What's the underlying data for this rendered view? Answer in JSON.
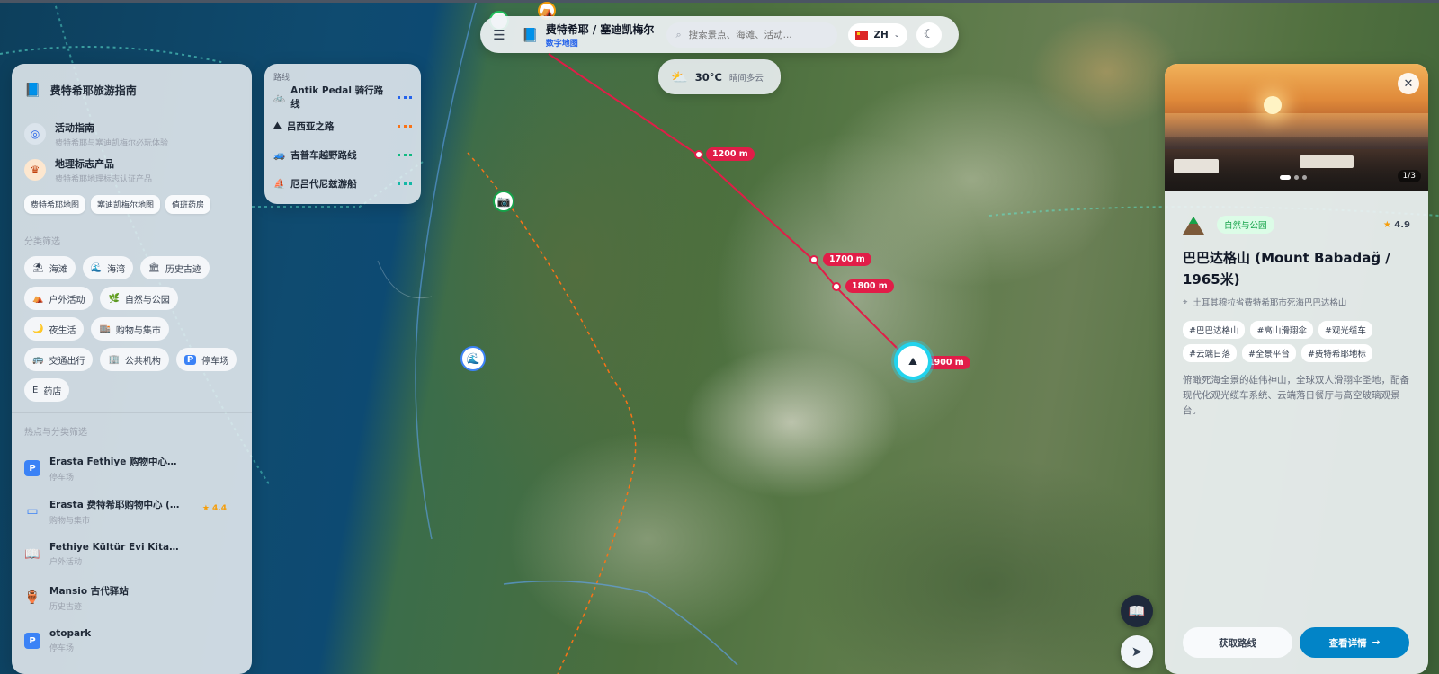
{
  "app": {
    "title": "费特希耶 / 塞迪凯梅尔",
    "subtitle": "数字地图"
  },
  "search": {
    "placeholder": "搜索景点、海滩、活动..."
  },
  "language": {
    "code": "ZH"
  },
  "weather": {
    "temp": "30°C",
    "desc": "晴间多云"
  },
  "left_panel": {
    "title": "费特希耶旅游指南",
    "nav": [
      {
        "title": "活动指南",
        "subtitle": "费特希耶与塞迪凯梅尔必玩体验",
        "icon": "compass-icon"
      },
      {
        "title": "地理标志产品",
        "subtitle": "费特希耶地理标志认证产品",
        "icon": "badge-icon"
      }
    ],
    "map_links": [
      "费特希耶地图",
      "塞迪凯梅尔地图",
      "值班药房"
    ],
    "category_label": "分类筛选",
    "categories": [
      {
        "label": "海滩",
        "icon": "umbrella-icon"
      },
      {
        "label": "海湾",
        "icon": "wave-icon"
      },
      {
        "label": "历史古迹",
        "icon": "temple-icon"
      },
      {
        "label": "户外活动",
        "icon": "tent-icon"
      },
      {
        "label": "自然与公园",
        "icon": "leaf-icon"
      },
      {
        "label": "夜生活",
        "icon": "moon-icon"
      },
      {
        "label": "购物与集市",
        "icon": "shop-icon"
      },
      {
        "label": "交通出行",
        "icon": "bus-icon"
      },
      {
        "label": "公共机构",
        "icon": "building-icon"
      },
      {
        "label": "停车场",
        "icon": "parking-icon"
      },
      {
        "label": "药店",
        "icon": "pharmacy-icon"
      }
    ],
    "poi_label": "热点与分类筛选",
    "pois": [
      {
        "name": "Erasta Fethiye 购物中心停车场",
        "category": "停车场",
        "icon": "parking-icon",
        "rating": ""
      },
      {
        "name": "Erasta 费特希耶购物中心 (E...",
        "category": "购物与集市",
        "icon": "card-icon",
        "rating": "4.4"
      },
      {
        "name": "Fethiye Kültür Evi Kitap Müzesi",
        "category": "户外活动",
        "icon": "book-icon",
        "rating": ""
      },
      {
        "name": "Mansio 古代驿站",
        "category": "历史古迹",
        "icon": "amphora-icon",
        "rating": ""
      },
      {
        "name": "otopark",
        "category": "停车场",
        "icon": "parking-icon",
        "rating": ""
      }
    ]
  },
  "routes": {
    "label": "路线",
    "items": [
      {
        "name": "Antik Pedal 骑行路线",
        "color": "#2563eb",
        "icon": "bike-icon"
      },
      {
        "name": "吕西亚之路",
        "color": "#f97316",
        "icon": "hiker-icon"
      },
      {
        "name": "吉普车越野路线",
        "color": "#10b981",
        "icon": "jeep-icon"
      },
      {
        "name": "厄吕代尼兹游船",
        "color": "#14b8a6",
        "icon": "boat-icon"
      }
    ]
  },
  "altitudes": [
    "1200 m",
    "1700 m",
    "1800 m",
    "1900 m"
  ],
  "detail": {
    "photo_counter": "1/3",
    "category": "自然与公园",
    "rating": "4.9",
    "title": "巴巴达格山 (Mount Babadağ / 1965米)",
    "location": "土耳其穆拉省费特希耶市死海巴巴达格山",
    "tags": [
      "#巴巴达格山",
      "#高山滑翔伞",
      "#观光缆车",
      "#云端日落",
      "#全景平台",
      "#费特希耶地标"
    ],
    "description": "俯瞰死海全景的雄伟神山，全球双人滑翔伞圣地，配备现代化观光缆车系统、云端落日餐厅与高空玻璃观景台。",
    "btn_route": "获取路线",
    "btn_detail": "查看详情"
  },
  "colors": {
    "accent": "#0284c7",
    "route_line": "#e11d48",
    "nature": "#16a34a"
  }
}
